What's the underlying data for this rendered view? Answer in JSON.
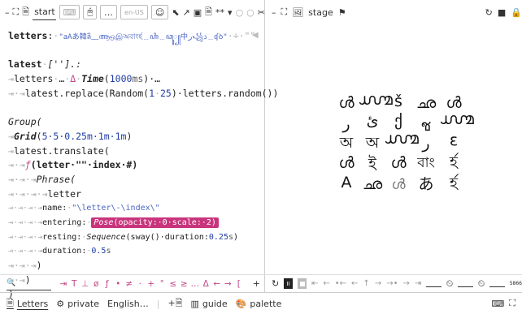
{
  "left_toolbar": {
    "collapse": "–",
    "expand": "⛶",
    "doc_icon": "🗎",
    "project_name": "start",
    "keyboard": "⌨",
    "mouse": "🖱",
    "more": "…",
    "locale": "en-US",
    "emoji": "☺",
    "tools": [
      "⬉",
      "↗",
      "▣",
      "🗎",
      "**",
      "▾",
      "○",
      "○",
      "✂"
    ]
  },
  "editor": {
    "l1": {
      "name": "letters",
      "colon": ":",
      "value": "\"aAあ韓ลิ﹏ആஒஇঅবাংর্হ﹍ꦲꦶ﹍ꦣꦸ꧀中ر꧁ڌ﹍ʠꝺ\"",
      "rest": "·÷·\"\""
    },
    "l2": {
      "name": "latest",
      "type": "[''].:"
    },
    "l3": {
      "name": "letters",
      "dots": "…",
      "delta": "Δ",
      "time": "Time",
      "ms_value": "1000",
      "ms_unit": "ms",
      "end": ")·…"
    },
    "l4": {
      "text": "latest.replace(Random(",
      "n1": "1",
      "sep": "·",
      "n2": "25",
      "mid": ")·letters.random())"
    },
    "l5": {
      "text": "Group("
    },
    "l6": {
      "grid": "Grid",
      "args": "5·5·0.25m·1m·1m",
      "end": ")"
    },
    "l7": {
      "text": "latest.translate("
    },
    "l8": {
      "f": "ƒ",
      "params": "(letter·\"\"·index·#)"
    },
    "l9": {
      "text": "Phrase("
    },
    "l10": {
      "text": "letter"
    },
    "l11": {
      "label": "name:",
      "value": "\"\\letter\\-\\index\\\""
    },
    "l12": {
      "label": "entering:",
      "fn": "Pose",
      "args": "(opacity:·0·scale:·2)"
    },
    "l13": {
      "label": "resting:",
      "fn": "Sequence",
      "args": "(sway()·duration:",
      "num": "0.25",
      "unit": "s",
      "end": ")"
    },
    "l14": {
      "label": "duration:",
      "num": "0.5",
      "unit": "s"
    },
    "l15": {
      "text": ")"
    },
    "l16": {
      "text": ")"
    },
    "l17": {
      "text": ")"
    }
  },
  "symbol_bar": {
    "search_icon": "🔍",
    "symbols": [
      "⇥",
      "T",
      "⊥",
      "ø",
      "ƒ",
      "•",
      "≠",
      "·",
      "+",
      "°",
      "≤",
      "≥",
      "…",
      "Δ",
      "←",
      "→",
      "["
    ],
    "add": "+"
  },
  "right_toolbar": {
    "collapse": "–",
    "expand": "⛶",
    "stage_icon": "🖼",
    "title": "stage",
    "pin": "⚑",
    "undo": "↻",
    "stop": "■",
    "lock": "🔒"
  },
  "stage": {
    "rows": [
      [
        "ൾ",
        "൸",
        "š",
        "ഛ",
        "ൾ"
      ],
      [
        "ر",
        "ئ",
        "ქ",
        "ช",
        "൸"
      ],
      [
        "অ",
        "অ",
        "൸",
        "ر",
        "ε"
      ],
      [
        "ൾ",
        "ই",
        "ൾ",
        "বাং",
        "র্হ"
      ],
      [
        "A",
        "ഛ",
        "ൾ",
        "あ",
        "র্হ"
      ]
    ]
  },
  "timeline": {
    "refresh": "↻",
    "play": "II",
    "stop": "■",
    "steps": [
      "⇤",
      "←",
      "•←",
      "←",
      "↑",
      "→",
      "→•",
      "→",
      "⇥"
    ],
    "clock": "⏲",
    "clock2": "⏲",
    "counter": "5866"
  },
  "bottom_bar": {
    "tabs": [
      {
        "icon": "🗎",
        "label": "Letters"
      },
      {
        "icon": "⚙",
        "label": "private"
      },
      {
        "icon": "",
        "label": "English…"
      },
      {
        "icon": "+🗎",
        "label": ""
      },
      {
        "icon": "▥",
        "label": "guide"
      },
      {
        "icon": "🎨",
        "label": "palette"
      }
    ],
    "right_icons": [
      "⌨",
      "⛶"
    ]
  }
}
